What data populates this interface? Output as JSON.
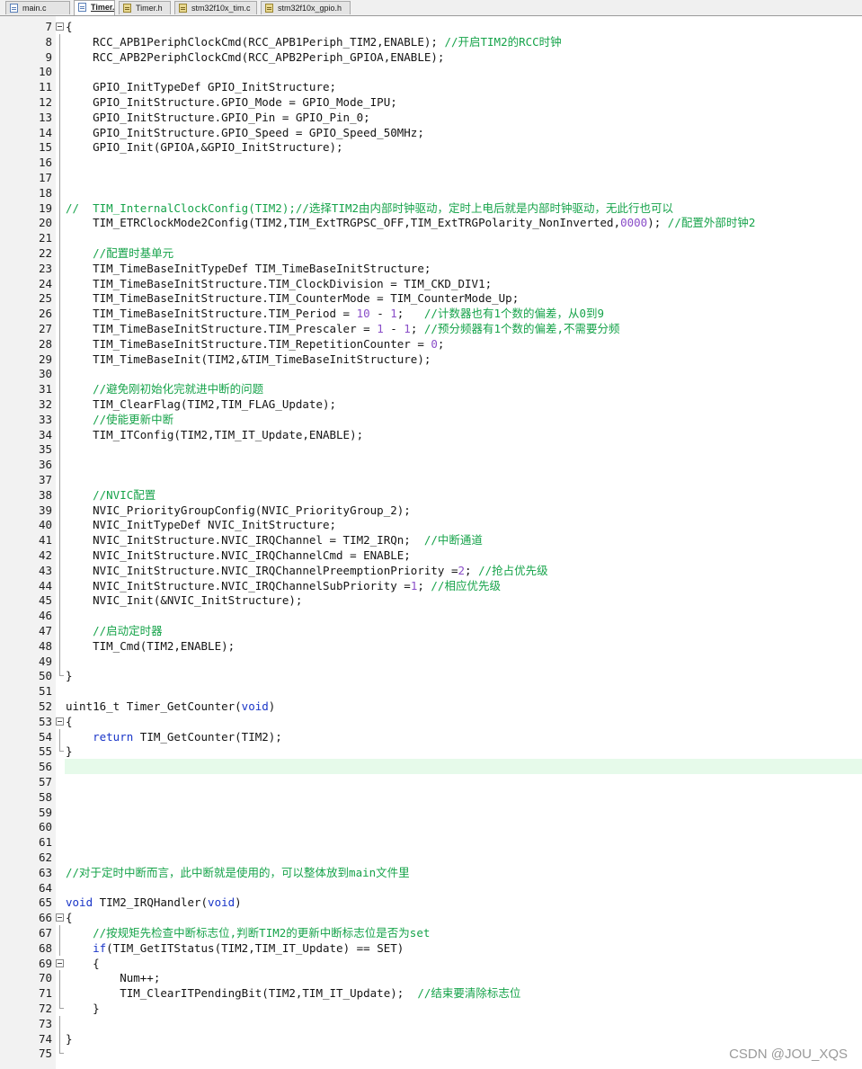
{
  "tabs": [
    {
      "label": "main.c",
      "type": "c",
      "active": false
    },
    {
      "label": "Timer.c",
      "type": "c",
      "active": true
    },
    {
      "label": "Timer.h",
      "type": "h",
      "active": false
    },
    {
      "label": "stm32f10x_tim.c",
      "type": "h",
      "active": false
    },
    {
      "label": "stm32f10x_gpio.h",
      "type": "h",
      "active": false
    }
  ],
  "watermark": "CSDN @JOU_XQS",
  "colors": {
    "comment": "#16a34a",
    "keyword": "#1a36c8",
    "number": "#8a4ec8",
    "current_line": "#e6faea"
  },
  "current_line": 56,
  "lines": [
    {
      "n": "7",
      "fold": "open",
      "segs": [
        [
          "{",
          "p"
        ]
      ]
    },
    {
      "n": "8",
      "fold": "line",
      "segs": [
        [
          "    RCC_APB1PeriphClockCmd(RCC_APB1Periph_TIM2,ENABLE); ",
          "p"
        ],
        [
          "//开启TIM2的RCC时钟",
          "c"
        ]
      ]
    },
    {
      "n": "9",
      "fold": "line",
      "segs": [
        [
          "    RCC_APB2PeriphClockCmd(RCC_APB2Periph_GPIOA,ENABLE);",
          "p"
        ]
      ]
    },
    {
      "n": "10",
      "fold": "line",
      "segs": []
    },
    {
      "n": "11",
      "fold": "line",
      "segs": [
        [
          "    GPIO_InitTypeDef GPIO_InitStructure;",
          "p"
        ]
      ]
    },
    {
      "n": "12",
      "fold": "line",
      "segs": [
        [
          "    GPIO_InitStructure.GPIO_Mode = GPIO_Mode_IPU;",
          "p"
        ]
      ]
    },
    {
      "n": "13",
      "fold": "line",
      "segs": [
        [
          "    GPIO_InitStructure.GPIO_Pin = GPIO_Pin_0;",
          "p"
        ]
      ]
    },
    {
      "n": "14",
      "fold": "line",
      "segs": [
        [
          "    GPIO_InitStructure.GPIO_Speed = GPIO_Speed_50MHz;",
          "p"
        ]
      ]
    },
    {
      "n": "15",
      "fold": "line",
      "segs": [
        [
          "    GPIO_Init(GPIOA,&GPIO_InitStructure);",
          "p"
        ]
      ]
    },
    {
      "n": "16",
      "fold": "line",
      "segs": []
    },
    {
      "n": "17",
      "fold": "line",
      "segs": []
    },
    {
      "n": "18",
      "fold": "line",
      "segs": []
    },
    {
      "n": "19",
      "fold": "line",
      "segs": [
        [
          "//  TIM_InternalClockConfig(TIM2);//选择TIM2由内部时钟驱动，定时上电后就是内部时钟驱动，无此行也可以",
          "c"
        ]
      ]
    },
    {
      "n": "20",
      "fold": "line",
      "segs": [
        [
          "    TIM_ETRClockMode2Config(TIM2,TIM_ExtTRGPSC_OFF,TIM_ExtTRGPolarity_NonInverted,",
          "p"
        ],
        [
          "0000",
          "n"
        ],
        [
          "); ",
          "p"
        ],
        [
          "//配置外部时钟2",
          "c"
        ]
      ]
    },
    {
      "n": "21",
      "fold": "line",
      "segs": []
    },
    {
      "n": "22",
      "fold": "line",
      "segs": [
        [
          "    ",
          "p"
        ],
        [
          "//配置时基单元",
          "c"
        ]
      ]
    },
    {
      "n": "23",
      "fold": "line",
      "segs": [
        [
          "    TIM_TimeBaseInitTypeDef TIM_TimeBaseInitStructure;",
          "p"
        ]
      ]
    },
    {
      "n": "24",
      "fold": "line",
      "segs": [
        [
          "    TIM_TimeBaseInitStructure.TIM_ClockDivision = TIM_CKD_DIV1;",
          "p"
        ]
      ]
    },
    {
      "n": "25",
      "fold": "line",
      "segs": [
        [
          "    TIM_TimeBaseInitStructure.TIM_CounterMode = TIM_CounterMode_Up;",
          "p"
        ]
      ]
    },
    {
      "n": "26",
      "fold": "line",
      "segs": [
        [
          "    TIM_TimeBaseInitStructure.TIM_Period = ",
          "p"
        ],
        [
          "10",
          "n"
        ],
        [
          " - ",
          "p"
        ],
        [
          "1",
          "n"
        ],
        [
          ";   ",
          "p"
        ],
        [
          "//计数器也有1个数的偏差，从0到9",
          "c"
        ]
      ]
    },
    {
      "n": "27",
      "fold": "line",
      "segs": [
        [
          "    TIM_TimeBaseInitStructure.TIM_Prescaler = ",
          "p"
        ],
        [
          "1",
          "n"
        ],
        [
          " - ",
          "p"
        ],
        [
          "1",
          "n"
        ],
        [
          "; ",
          "p"
        ],
        [
          "//预分频器有1个数的偏差,不需要分频",
          "c"
        ]
      ]
    },
    {
      "n": "28",
      "fold": "line",
      "segs": [
        [
          "    TIM_TimeBaseInitStructure.TIM_RepetitionCounter = ",
          "p"
        ],
        [
          "0",
          "n"
        ],
        [
          ";",
          "p"
        ]
      ]
    },
    {
      "n": "29",
      "fold": "line",
      "segs": [
        [
          "    TIM_TimeBaseInit(TIM2,&TIM_TimeBaseInitStructure);",
          "p"
        ]
      ]
    },
    {
      "n": "30",
      "fold": "line",
      "segs": []
    },
    {
      "n": "31",
      "fold": "line",
      "segs": [
        [
          "    ",
          "p"
        ],
        [
          "//避免刚初始化完就进中断的问题",
          "c"
        ]
      ]
    },
    {
      "n": "32",
      "fold": "line",
      "segs": [
        [
          "    TIM_ClearFlag(TIM2,TIM_FLAG_Update);",
          "p"
        ]
      ]
    },
    {
      "n": "33",
      "fold": "line",
      "segs": [
        [
          "    ",
          "p"
        ],
        [
          "//使能更新中断",
          "c"
        ]
      ]
    },
    {
      "n": "34",
      "fold": "line",
      "segs": [
        [
          "    TIM_ITConfig(TIM2,TIM_IT_Update,ENABLE);",
          "p"
        ]
      ]
    },
    {
      "n": "35",
      "fold": "line",
      "segs": []
    },
    {
      "n": "36",
      "fold": "line",
      "segs": []
    },
    {
      "n": "37",
      "fold": "line",
      "segs": []
    },
    {
      "n": "38",
      "fold": "line",
      "segs": [
        [
          "    ",
          "p"
        ],
        [
          "//NVIC配置",
          "c"
        ]
      ]
    },
    {
      "n": "39",
      "fold": "line",
      "segs": [
        [
          "    NVIC_PriorityGroupConfig(NVIC_PriorityGroup_2);",
          "p"
        ]
      ]
    },
    {
      "n": "40",
      "fold": "line",
      "segs": [
        [
          "    NVIC_InitTypeDef NVIC_InitStructure;",
          "p"
        ]
      ]
    },
    {
      "n": "41",
      "fold": "line",
      "segs": [
        [
          "    NVIC_InitStructure.NVIC_IRQChannel = TIM2_IRQn;  ",
          "p"
        ],
        [
          "//中断通道",
          "c"
        ]
      ]
    },
    {
      "n": "42",
      "fold": "line",
      "segs": [
        [
          "    NVIC_InitStructure.NVIC_IRQChannelCmd = ENABLE;",
          "p"
        ]
      ]
    },
    {
      "n": "43",
      "fold": "line",
      "segs": [
        [
          "    NVIC_InitStructure.NVIC_IRQChannelPreemptionPriority =",
          "p"
        ],
        [
          "2",
          "n"
        ],
        [
          "; ",
          "p"
        ],
        [
          "//抢占优先级",
          "c"
        ]
      ]
    },
    {
      "n": "44",
      "fold": "line",
      "segs": [
        [
          "    NVIC_InitStructure.NVIC_IRQChannelSubPriority =",
          "p"
        ],
        [
          "1",
          "n"
        ],
        [
          "; ",
          "p"
        ],
        [
          "//相应优先级",
          "c"
        ]
      ]
    },
    {
      "n": "45",
      "fold": "line",
      "segs": [
        [
          "    NVIC_Init(&NVIC_InitStructure);",
          "p"
        ]
      ]
    },
    {
      "n": "46",
      "fold": "line",
      "segs": []
    },
    {
      "n": "47",
      "fold": "line",
      "segs": [
        [
          "    ",
          "p"
        ],
        [
          "//启动定时器",
          "c"
        ]
      ]
    },
    {
      "n": "48",
      "fold": "line",
      "segs": [
        [
          "    TIM_Cmd(TIM2,ENABLE);",
          "p"
        ]
      ]
    },
    {
      "n": "49",
      "fold": "line",
      "segs": []
    },
    {
      "n": "50",
      "fold": "end",
      "segs": [
        [
          "}",
          "p"
        ]
      ]
    },
    {
      "n": "51",
      "fold": "",
      "segs": []
    },
    {
      "n": "52",
      "fold": "",
      "segs": [
        [
          "uint16_t Timer_GetCounter(",
          "p"
        ],
        [
          "void",
          "k"
        ],
        [
          ")",
          "p"
        ]
      ]
    },
    {
      "n": "53",
      "fold": "open",
      "segs": [
        [
          "{",
          "p"
        ]
      ]
    },
    {
      "n": "54",
      "fold": "line",
      "segs": [
        [
          "    ",
          "p"
        ],
        [
          "return",
          "k"
        ],
        [
          " TIM_GetCounter(TIM2);",
          "p"
        ]
      ]
    },
    {
      "n": "55",
      "fold": "end",
      "segs": [
        [
          "}",
          "p"
        ]
      ]
    },
    {
      "n": "56",
      "fold": "",
      "segs": []
    },
    {
      "n": "57",
      "fold": "",
      "segs": []
    },
    {
      "n": "58",
      "fold": "",
      "segs": []
    },
    {
      "n": "59",
      "fold": "",
      "segs": []
    },
    {
      "n": "60",
      "fold": "",
      "segs": []
    },
    {
      "n": "61",
      "fold": "",
      "segs": []
    },
    {
      "n": "62",
      "fold": "",
      "segs": []
    },
    {
      "n": "63",
      "fold": "",
      "segs": [
        [
          "//对于定时中断而言，此中断就是使用的，可以整体放到main文件里",
          "c"
        ]
      ]
    },
    {
      "n": "64",
      "fold": "",
      "segs": []
    },
    {
      "n": "65",
      "fold": "",
      "segs": [
        [
          "void",
          "k"
        ],
        [
          " TIM2_IRQHandler(",
          "p"
        ],
        [
          "void",
          "k"
        ],
        [
          ")",
          "p"
        ]
      ]
    },
    {
      "n": "66",
      "fold": "open",
      "segs": [
        [
          "{",
          "p"
        ]
      ]
    },
    {
      "n": "67",
      "fold": "line",
      "segs": [
        [
          "    ",
          "p"
        ],
        [
          "//按规矩先检查中断标志位,判断TIM2的更新中断标志位是否为set",
          "c"
        ]
      ]
    },
    {
      "n": "68",
      "fold": "line",
      "segs": [
        [
          "    ",
          "p"
        ],
        [
          "if",
          "k"
        ],
        [
          "(TIM_GetITStatus(TIM2,TIM_IT_Update) == SET)",
          "p"
        ]
      ]
    },
    {
      "n": "69",
      "fold": "open",
      "segs": [
        [
          "    {",
          "p"
        ]
      ]
    },
    {
      "n": "70",
      "fold": "line",
      "segs": [
        [
          "        Num++;",
          "p"
        ]
      ]
    },
    {
      "n": "71",
      "fold": "line",
      "segs": [
        [
          "        TIM_ClearITPendingBit(TIM2,TIM_IT_Update);  ",
          "p"
        ],
        [
          "//结束要清除标志位",
          "c"
        ]
      ]
    },
    {
      "n": "72",
      "fold": "end",
      "segs": [
        [
          "    }",
          "p"
        ]
      ]
    },
    {
      "n": "73",
      "fold": "line",
      "segs": []
    },
    {
      "n": "74",
      "fold": "line",
      "segs": [
        [
          "}",
          "p"
        ]
      ]
    },
    {
      "n": "75",
      "fold": "end",
      "segs": []
    }
  ]
}
